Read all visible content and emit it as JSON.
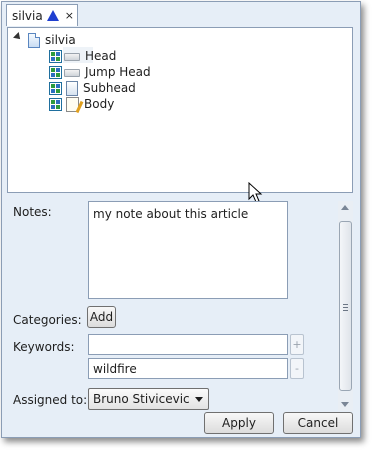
{
  "tab": {
    "label": "silvia",
    "close": "×"
  },
  "tree": {
    "root": "silvia",
    "children": [
      {
        "label": "Head",
        "type": "head"
      },
      {
        "label": "Jump Head",
        "type": "head"
      },
      {
        "label": "Subhead",
        "type": "subhead"
      },
      {
        "label": "Body",
        "type": "body"
      }
    ]
  },
  "form": {
    "notes_label": "Notes:",
    "notes_value": "my note about this article",
    "categories_label": "Categories:",
    "add_label": "Add",
    "keywords_label": "Keywords:",
    "keyword_new": "",
    "keyword_1": "wildfire",
    "plus": "+",
    "minus": "-",
    "assigned_label": "Assigned to:",
    "assigned_value": "Bruno Stivicevic"
  },
  "buttons": {
    "apply": "Apply",
    "cancel": "Cancel"
  }
}
